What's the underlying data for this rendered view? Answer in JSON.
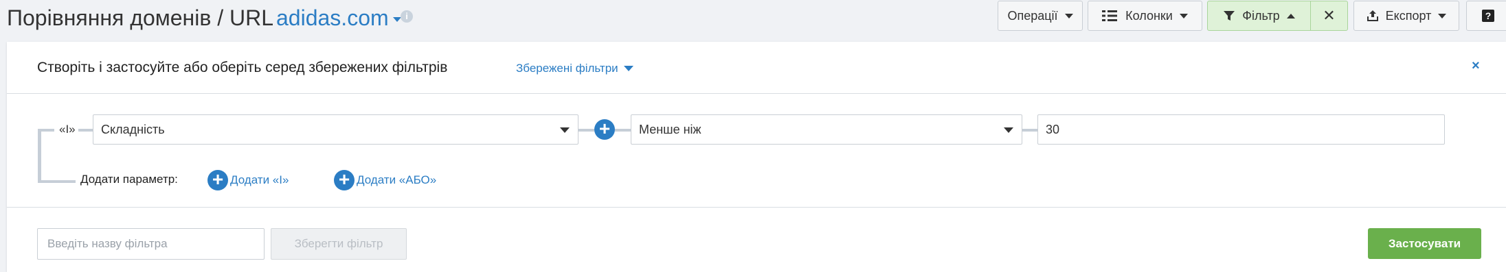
{
  "header": {
    "title": "Порівняння доменів / URL",
    "domain": "adidas.com",
    "info_icon": "i",
    "buttons": {
      "operations": "Операції",
      "columns": "Колонки",
      "filter": "Фільтр",
      "filter_close": "✕",
      "export": "Експорт",
      "help": "?"
    }
  },
  "filter_panel": {
    "heading": "Створіть і застосуйте або оберіть серед збережених фільтрів",
    "saved_filters": "Збережені фільтри",
    "close": "×",
    "condition": {
      "connector": "«І»",
      "parameter": "Складність",
      "operator": "Менше ніж",
      "value": "30"
    },
    "add_parameter_label": "Додати параметр:",
    "add_and": "Додати «І»",
    "add_or": "Додати «АБО»",
    "filter_name_placeholder": "Введіть назву фільтра",
    "save_filter": "Зберегти фільтр",
    "apply": "Застосувати"
  },
  "icons": [
    "info-icon",
    "operations-caret-icon",
    "columns-icon",
    "filter-funnel-icon",
    "close-icon",
    "export-icon",
    "help-icon",
    "plus-circle-icon",
    "dropdown-arrow-icon"
  ],
  "colors": {
    "link_blue": "#2b7dc4",
    "filter_active_bg": "#dff2d8",
    "apply_green": "#6ab04c"
  }
}
